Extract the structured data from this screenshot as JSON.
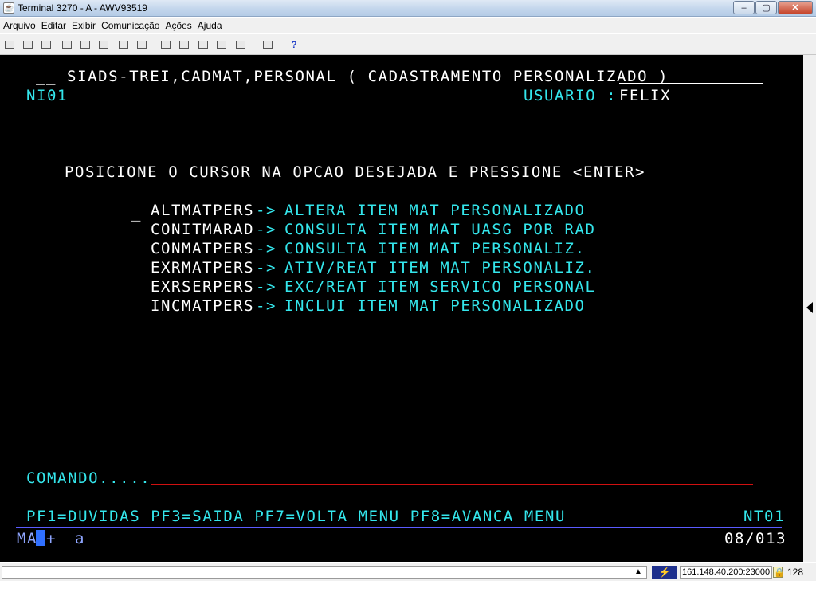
{
  "window": {
    "title": "Terminal 3270 - A - AWV93519",
    "buttons": {
      "minimize": "–",
      "maximize": "▢",
      "close": "✕"
    }
  },
  "menu": [
    "Arquivo",
    "Editar",
    "Exibir",
    "Comunicação",
    "Ações",
    "Ajuda"
  ],
  "toolbar": {
    "icons": [
      "print-screen-icon",
      "print-setup-icon",
      "transfer-icon",
      "copy-icon",
      "paste-icon",
      "copy-append-icon",
      "macro-icon",
      "keypad-icon",
      "record-macro-icon",
      "stop-macro-icon",
      "play-macro-icon",
      "quick-icon",
      "print-icon",
      "help-icon"
    ],
    "help_label": "?"
  },
  "terminal": {
    "line1": "__ SIADS-TREI,CADMAT,PERSONAL ( CADASTRAMENTO PERSONALIZADO )",
    "screen_id": "NI01",
    "user_label": "USUARIO :",
    "user_value": "FELIX",
    "instruction": "POSICIONE O CURSOR NA OPCAO DESEJADA E PRESSIONE <ENTER>",
    "option_cursor": "_",
    "options": [
      {
        "code": "ALTMATPERS",
        "arrow": "->",
        "desc": "ALTERA ITEM MAT PERSONALIZADO"
      },
      {
        "code": "CONITMARAD",
        "arrow": "->",
        "desc": "CONSULTA ITEM MAT UASG POR RAD"
      },
      {
        "code": "CONMATPERS",
        "arrow": "->",
        "desc": "CONSULTA ITEM MAT PERSONALIZ."
      },
      {
        "code": "EXRMATPERS",
        "arrow": "->",
        "desc": "ATIV/REAT ITEM MAT PERSONALIZ."
      },
      {
        "code": "EXRSERPERS",
        "arrow": "->",
        "desc": "EXC/REAT ITEM SERVICO PERSONAL"
      },
      {
        "code": "INCMATPERS",
        "arrow": "->",
        "desc": "INCLUI ITEM MAT PERSONALIZADO"
      }
    ],
    "command_label": "COMANDO.....",
    "command_value": "",
    "pf_keys": "PF1=DUVIDAS PF3=SAIDA PF7=VOLTA MENU PF8=AVANCA MENU",
    "pf_screen_id": "NT01",
    "oia_left": "MA",
    "oia_plus": "+",
    "oia_a": "a",
    "cursor_position": "08/013"
  },
  "statusbar": {
    "host": "161.148.40.200:23000",
    "bits": "128",
    "up_arrow": "▲"
  },
  "colors": {
    "terminal_bg": "#000000",
    "field_protected": "#ffffff",
    "field_cyan": "#34e6ec",
    "command_underline": "#d01010",
    "oia_line": "#5b5bff",
    "cursor": "#3070ff"
  }
}
